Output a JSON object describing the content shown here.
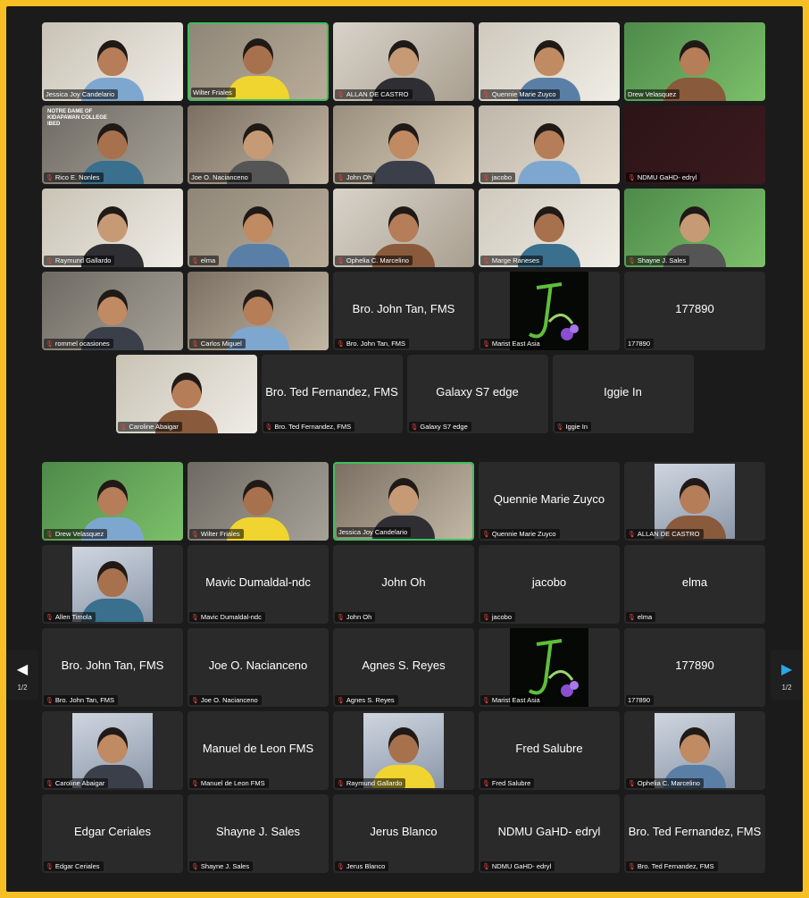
{
  "colors": {
    "frame_border": "#f6c025",
    "background": "#1b1b1b",
    "tile": "#2a2a2a",
    "speaking": "#3fbf5c",
    "mic_muted": "#e0473d",
    "nav_arrow_right": "#2aa7e8"
  },
  "pages": [
    {
      "rows": [
        [
          {
            "name": "Jessica Joy Candelario",
            "video": true,
            "muted": false
          },
          {
            "name": "Wilter Friales",
            "video": true,
            "muted": false,
            "speaking": true
          },
          {
            "name": "ALLAN DE CASTRO",
            "video": true,
            "muted": true
          },
          {
            "name": "Quennie Marie Zuyco",
            "video": true,
            "muted": true
          },
          {
            "name": "Drew Velasquez",
            "video": true,
            "muted": false
          }
        ],
        [
          {
            "name": "Rico E. Nonles",
            "video": true,
            "muted": true,
            "banner": "NOTRE DAME OF KIDAPAWAN COLLEGE IBED"
          },
          {
            "name": "Joe O. Nacianceno",
            "video": true,
            "muted": false
          },
          {
            "name": "John Oh",
            "video": true,
            "muted": true
          },
          {
            "name": "jacobo",
            "video": true,
            "muted": true
          },
          {
            "name": "NDMU GaHD- edryl",
            "video": true,
            "muted": true,
            "dark": true
          }
        ],
        [
          {
            "name": "Raymund Gallardo",
            "video": true,
            "muted": true
          },
          {
            "name": "elma",
            "video": true,
            "muted": true
          },
          {
            "name": "Ophelia  C. Marcelino",
            "video": true,
            "muted": true
          },
          {
            "name": "Marge Raneses",
            "video": true,
            "muted": true
          },
          {
            "name": "Shayne J. Sales",
            "video": true,
            "muted": true
          }
        ],
        [
          {
            "name": "rommel ocasiones",
            "video": true,
            "muted": true
          },
          {
            "name": "Carlos Miguel",
            "video": true,
            "muted": true
          },
          {
            "name": "Bro. John Tan, FMS",
            "video": false,
            "muted": true,
            "display": "Bro. John Tan, FMS"
          },
          {
            "name": "Marist East Asia",
            "logo": true,
            "muted": true
          },
          {
            "name": "177890",
            "video": false,
            "muted": false,
            "display": "177890"
          }
        ],
        [
          {
            "name": "Caroline Abaigar",
            "video": true,
            "muted": true
          },
          {
            "name": "Bro. Ted Fernandez, FMS",
            "video": false,
            "muted": true,
            "display": "Bro. Ted Fernandez, FMS"
          },
          {
            "name": "Galaxy S7 edge",
            "video": false,
            "muted": true,
            "display": "Galaxy S7 edge"
          },
          {
            "name": "Iggie In",
            "video": false,
            "muted": true,
            "display": "Iggie In"
          }
        ]
      ]
    },
    {
      "rows": [
        [
          {
            "name": "Drew Velasquez",
            "video": true,
            "muted": true
          },
          {
            "name": "Wilter Friales",
            "video": true,
            "muted": true
          },
          {
            "name": "Jessica Joy Candelario",
            "video": true,
            "muted": false,
            "speaking": true
          },
          {
            "name": "Quennie Marie Zuyco",
            "video": false,
            "muted": true,
            "display": "Quennie Marie Zuyco"
          },
          {
            "name": "ALLAN DE CASTRO",
            "avatar": true,
            "muted": true
          }
        ],
        [
          {
            "name": "Allen Timola",
            "avatar": true,
            "muted": true
          },
          {
            "name": "Mavic Dumaldal-ndc",
            "video": false,
            "muted": true,
            "display": "Mavic Dumaldal-ndc"
          },
          {
            "name": "John Oh",
            "video": false,
            "muted": true,
            "display": "John Oh"
          },
          {
            "name": "jacobo",
            "video": false,
            "muted": true,
            "display": "jacobo"
          },
          {
            "name": "elma",
            "video": false,
            "muted": true,
            "display": "elma"
          }
        ],
        [
          {
            "name": "Bro. John Tan, FMS",
            "video": false,
            "muted": true,
            "display": "Bro. John Tan, FMS"
          },
          {
            "name": "Joe O. Nacianceno",
            "video": false,
            "muted": true,
            "display": "Joe O. Nacianceno"
          },
          {
            "name": "Agnes S. Reyes",
            "video": false,
            "muted": true,
            "display": "Agnes S. Reyes"
          },
          {
            "name": "Marist East Asia",
            "logo": true,
            "muted": true
          },
          {
            "name": "177890",
            "video": false,
            "muted": false,
            "display": "177890"
          }
        ],
        [
          {
            "name": "Caroline Abaigar",
            "avatar": true,
            "muted": true
          },
          {
            "name": "Manuel de Leon FMS",
            "video": false,
            "muted": true,
            "display": "Manuel de Leon FMS"
          },
          {
            "name": "Raymund Gallardo",
            "avatar": true,
            "muted": true
          },
          {
            "name": "Fred Salubre",
            "video": false,
            "muted": true,
            "display": "Fred Salubre"
          },
          {
            "name": "Ophelia  C. Marcelino",
            "avatar": true,
            "muted": true
          }
        ],
        [
          {
            "name": "Edgar Ceriales",
            "video": false,
            "muted": true,
            "display": "Edgar Ceriales"
          },
          {
            "name": "Shayne J. Sales",
            "video": false,
            "muted": true,
            "display": "Shayne J. Sales"
          },
          {
            "name": "Jerus Blanco",
            "video": false,
            "muted": true,
            "display": "Jerus Blanco"
          },
          {
            "name": "NDMU GaHD- edryl",
            "video": false,
            "muted": true,
            "display": "NDMU GaHD- edryl"
          },
          {
            "name": "Bro. Ted Fernandez, FMS",
            "video": false,
            "muted": true,
            "display": "Bro. Ted Fernandez, FMS"
          }
        ]
      ]
    }
  ],
  "nav": {
    "left": {
      "icon": "chevron-left-icon",
      "page": "1/2"
    },
    "right": {
      "icon": "chevron-right-icon",
      "page": "1/2"
    }
  }
}
